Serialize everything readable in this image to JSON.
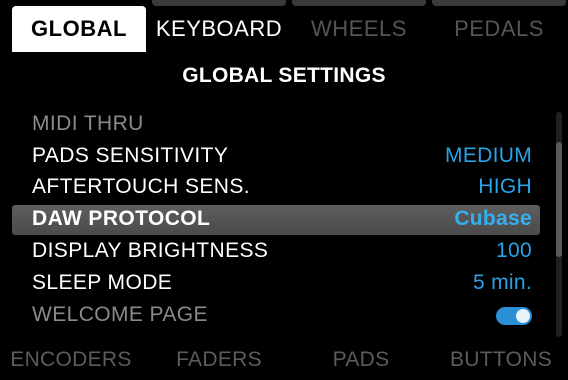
{
  "top_tabs": [
    {
      "label": "GLOBAL",
      "active": true
    },
    {
      "label": "KEYBOARD",
      "active": false
    },
    {
      "label": "WHEELS",
      "active": false
    },
    {
      "label": "PEDALS",
      "active": false
    }
  ],
  "header": {
    "title": "GLOBAL SETTINGS"
  },
  "settings": [
    {
      "label": "MIDI THRU",
      "value": ""
    },
    {
      "label": "PADS SENSITIVITY",
      "value": "MEDIUM"
    },
    {
      "label": "AFTERTOUCH SENS.",
      "value": "HIGH"
    },
    {
      "label": "DAW PROTOCOL",
      "value": "Cubase",
      "selected": true
    },
    {
      "label": "DISPLAY BRIGHTNESS",
      "value": "100"
    },
    {
      "label": "SLEEP MODE",
      "value": "5 min."
    },
    {
      "label": "WELCOME PAGE",
      "toggle_on": true
    }
  ],
  "bottom_tabs": [
    {
      "label": "ENCODERS"
    },
    {
      "label": "FADERS"
    },
    {
      "label": "PADS"
    },
    {
      "label": "BUTTONS"
    }
  ],
  "colors": {
    "accent": "#27a3e6",
    "selected_row": "#555555",
    "inactive_text": "#5c5c5c"
  }
}
